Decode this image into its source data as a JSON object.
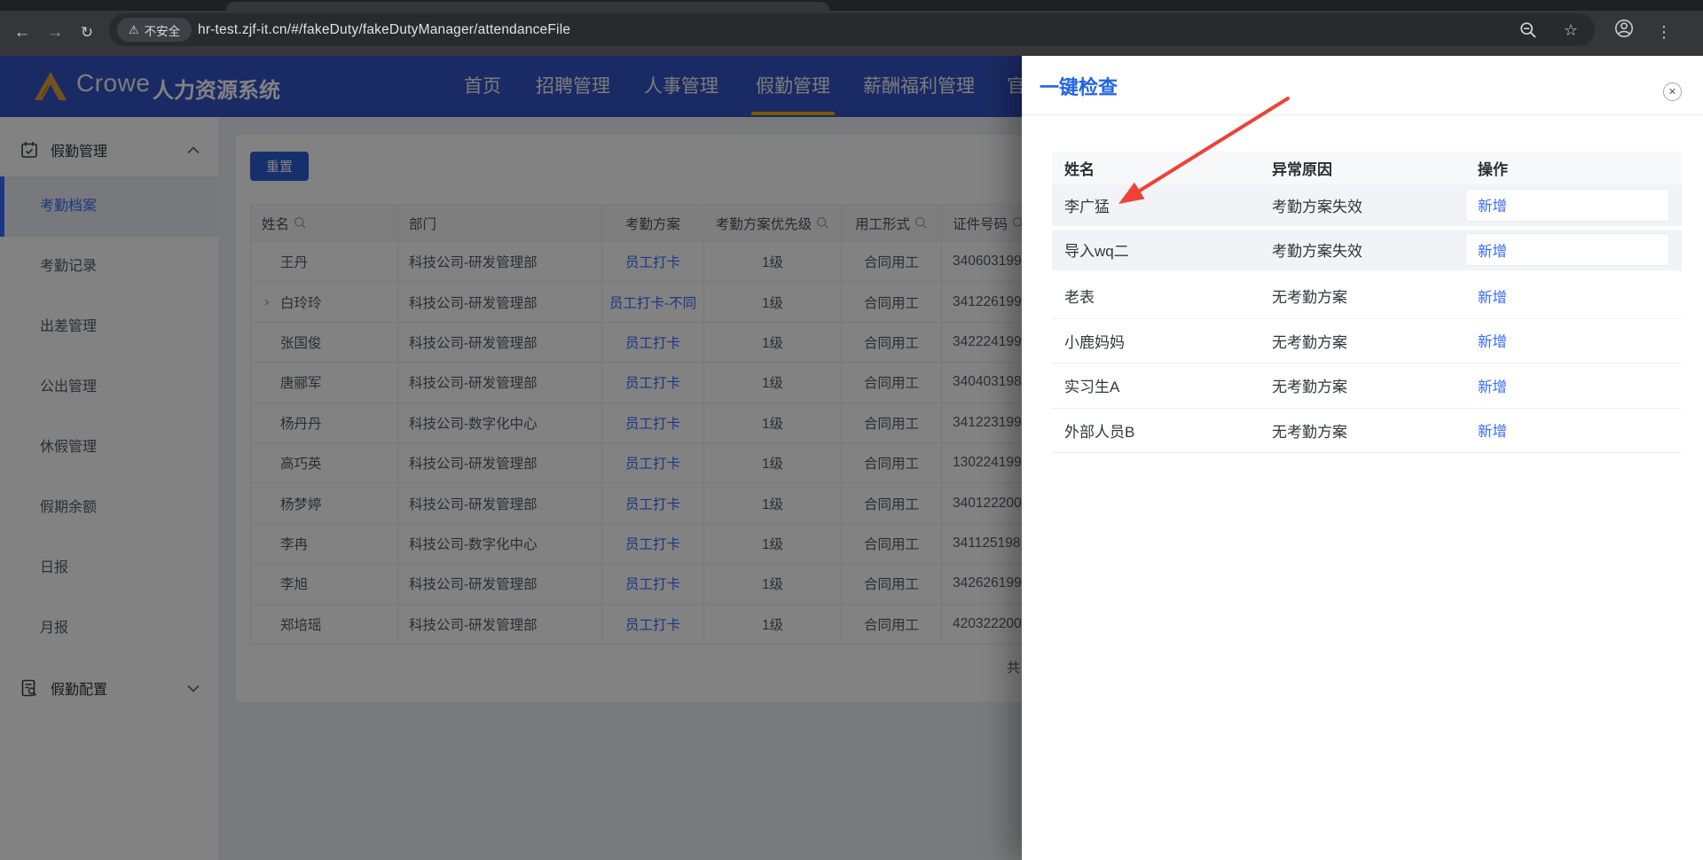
{
  "browser": {
    "security_label": "不安全",
    "url": "hr-test.zjf-it.cn/#/fakeDuty/fakeDutyManager/attendanceFile",
    "icons": {
      "back": "←",
      "forward": "→",
      "reload": "↻",
      "warning": "⚠",
      "star": "☆",
      "menu": "⋮"
    }
  },
  "navbar": {
    "brand": "Crowe",
    "system_title": "人力资源系统",
    "items": [
      {
        "label": "首页",
        "active": false
      },
      {
        "label": "招聘管理",
        "active": false
      },
      {
        "label": "人事管理",
        "active": false
      },
      {
        "label": "假勤管理",
        "active": true
      },
      {
        "label": "薪酬福利管理",
        "active": false
      },
      {
        "label": "官",
        "active": false,
        "clipped": true
      }
    ]
  },
  "sidebar": {
    "groups": [
      {
        "label": "假勤管理",
        "icon": "calendar-check-icon",
        "expanded": true
      },
      {
        "label": "假勤配置",
        "icon": "doc-search-icon",
        "expanded": false
      }
    ],
    "items": [
      {
        "label": "考勤档案",
        "active": true
      },
      {
        "label": "考勤记录",
        "active": false
      },
      {
        "label": "出差管理",
        "active": false
      },
      {
        "label": "公出管理",
        "active": false
      },
      {
        "label": "休假管理",
        "active": false
      },
      {
        "label": "假期余额",
        "active": false
      },
      {
        "label": "日报",
        "active": false
      },
      {
        "label": "月报",
        "active": false
      }
    ]
  },
  "main": {
    "reset_label": "重置",
    "pagination_text": "共",
    "table": {
      "columns": [
        {
          "label": "姓名",
          "searchable": true
        },
        {
          "label": "部门",
          "searchable": false
        },
        {
          "label": "考勤方案",
          "searchable": false
        },
        {
          "label": "考勤方案优先级",
          "searchable": true
        },
        {
          "label": "用工形式",
          "searchable": true
        },
        {
          "label": "证件号码",
          "searchable": true
        }
      ],
      "rows": [
        {
          "name": "王丹",
          "dept": "科技公司-研发管理部",
          "plan": "员工打卡",
          "priority": "1级",
          "type": "合同用工",
          "id": "340603199",
          "expandable": false
        },
        {
          "name": "白玲玲",
          "dept": "科技公司-研发管理部",
          "plan": "员工打卡-不同",
          "priority": "1级",
          "type": "合同用工",
          "id": "341226199",
          "expandable": true
        },
        {
          "name": "张国俊",
          "dept": "科技公司-研发管理部",
          "plan": "员工打卡",
          "priority": "1级",
          "type": "合同用工",
          "id": "342224199",
          "expandable": false
        },
        {
          "name": "唐郦军",
          "dept": "科技公司-研发管理部",
          "plan": "员工打卡",
          "priority": "1级",
          "type": "合同用工",
          "id": "340403198",
          "expandable": false
        },
        {
          "name": "杨丹丹",
          "dept": "科技公司-数字化中心",
          "plan": "员工打卡",
          "priority": "1级",
          "type": "合同用工",
          "id": "341223199",
          "expandable": false
        },
        {
          "name": "高巧英",
          "dept": "科技公司-研发管理部",
          "plan": "员工打卡",
          "priority": "1级",
          "type": "合同用工",
          "id": "130224199",
          "expandable": false
        },
        {
          "name": "杨梦婷",
          "dept": "科技公司-研发管理部",
          "plan": "员工打卡",
          "priority": "1级",
          "type": "合同用工",
          "id": "340122200",
          "expandable": false
        },
        {
          "name": "李冉",
          "dept": "科技公司-数字化中心",
          "plan": "员工打卡",
          "priority": "1级",
          "type": "合同用工",
          "id": "341125198",
          "expandable": false
        },
        {
          "name": "李旭",
          "dept": "科技公司-研发管理部",
          "plan": "员工打卡",
          "priority": "1级",
          "type": "合同用工",
          "id": "342626199",
          "expandable": false
        },
        {
          "name": "郑培瑶",
          "dept": "科技公司-研发管理部",
          "plan": "员工打卡",
          "priority": "1级",
          "type": "合同用工",
          "id": "420322200",
          "expandable": false
        }
      ]
    }
  },
  "drawer": {
    "title": "一键检查",
    "close_glyph": "✕",
    "columns": [
      "姓名",
      "异常原因",
      "操作"
    ],
    "rows": [
      {
        "name": "李广猛",
        "reason": "考勤方案失效",
        "action": "新增",
        "highlighted": true
      },
      {
        "name": "导入wq二",
        "reason": "考勤方案失效",
        "action": "新增",
        "highlighted": true
      },
      {
        "name": "老表",
        "reason": "无考勤方案",
        "action": "新增",
        "highlighted": false
      },
      {
        "name": "小鹿妈妈",
        "reason": "无考勤方案",
        "action": "新增",
        "highlighted": false
      },
      {
        "name": "实习生A",
        "reason": "无考勤方案",
        "action": "新增",
        "highlighted": false
      },
      {
        "name": "外部人员B",
        "reason": "无考勤方案",
        "action": "新增",
        "highlighted": false
      }
    ]
  },
  "colors": {
    "navbar_bg": "#3353c4",
    "accent_blue": "#3a6aff",
    "drawer_title_blue": "#2263e8",
    "active_underline": "#f0ad00",
    "logo_gold": "#e2a33a",
    "annotation_arrow_red": "#ee4237",
    "overlay": "rgba(0,0,0,0.49)"
  }
}
